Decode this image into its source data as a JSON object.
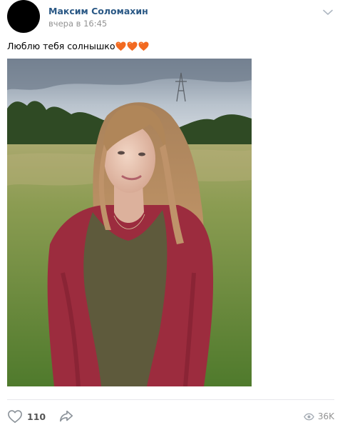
{
  "post": {
    "author_name": "Максим Соломахин",
    "timestamp": "вчера в 16:45",
    "text": "Люблю тебя солнышко",
    "text_emoji": [
      "orange-heart",
      "orange-heart",
      "orange-heart"
    ],
    "photo_description": "Photo of a girl in a red cardigan in a grass field",
    "menu_icon": "chevron-down-icon"
  },
  "footer": {
    "likes_count": "110",
    "like_icon": "heart-outline-icon",
    "share_icon": "share-arrow-icon",
    "views_icon": "eye-icon",
    "views_count": "36K"
  },
  "colors": {
    "author_link": "#2a5885",
    "secondary_text": "#939393",
    "divider": "#e7e8ec",
    "heart_emoji": "#f26a21"
  }
}
